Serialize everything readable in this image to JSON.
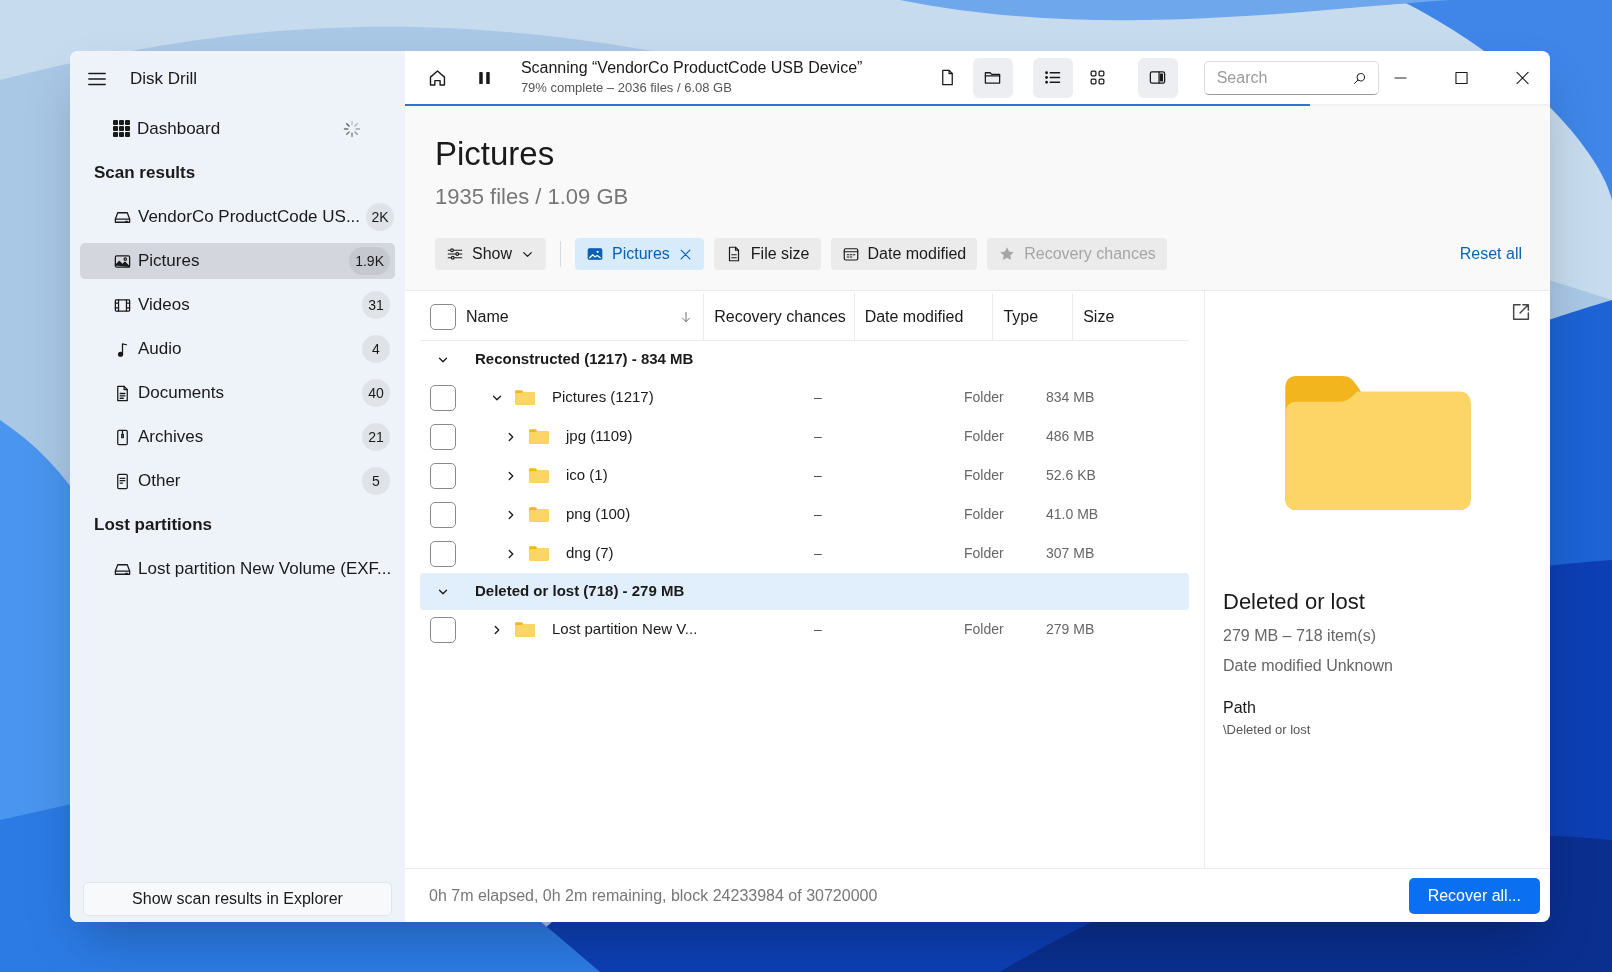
{
  "app": {
    "title": "Disk Drill"
  },
  "sidebar": {
    "dashboard": {
      "label": "Dashboard",
      "loading": true
    },
    "sections": [
      {
        "title": "Scan results",
        "items": [
          {
            "kind": "drive",
            "label": "VendorCo ProductCode US...",
            "count": "2K",
            "selected": false
          },
          {
            "kind": "picture",
            "label": "Pictures",
            "count": "1.9K",
            "selected": true
          },
          {
            "kind": "video",
            "label": "Videos",
            "count": "31",
            "selected": false
          },
          {
            "kind": "audio",
            "label": "Audio",
            "count": "4",
            "selected": false
          },
          {
            "kind": "document",
            "label": "Documents",
            "count": "40",
            "selected": false
          },
          {
            "kind": "archive",
            "label": "Archives",
            "count": "21",
            "selected": false
          },
          {
            "kind": "other",
            "label": "Other",
            "count": "5",
            "selected": false
          }
        ]
      },
      {
        "title": "Lost partitions",
        "items": [
          {
            "kind": "drive",
            "label": "Lost partition New Volume (EXF...",
            "selected": false
          }
        ]
      }
    ],
    "footer_button": "Show scan results in Explorer"
  },
  "toolbar": {
    "scan_title": "Scanning “VendorCo ProductCode USB Device”",
    "scan_status": "79% complete – 2036 files / 6.08 GB",
    "progress": {
      "level": 0.79
    },
    "view_buttons": [
      {
        "kind": "file",
        "selected": false
      },
      {
        "kind": "folder",
        "selected": true
      },
      {
        "kind": "list",
        "selected": true
      },
      {
        "kind": "grid",
        "selected": false
      },
      {
        "kind": "panel",
        "selected": true
      }
    ],
    "search": {
      "placeholder": "Search"
    }
  },
  "header": {
    "title": "Pictures",
    "subtitle": "1935 files / 1.09 GB"
  },
  "filters": [
    {
      "kind": "show",
      "label": "Show",
      "active": false,
      "disabled": false
    },
    {
      "kind": "picture",
      "label": "Pictures",
      "active": true,
      "disabled": false
    },
    {
      "kind": "file",
      "label": "File size",
      "active": false,
      "disabled": false
    },
    {
      "kind": "calendar",
      "label": "Date modified",
      "active": false,
      "disabled": false
    },
    {
      "kind": "star",
      "label": "Recovery chances",
      "active": false,
      "disabled": true
    }
  ],
  "reset_link": "Reset all",
  "table": {
    "select_all": {
      "checked": false
    },
    "columns": [
      "Name",
      "Recovery chances",
      "Date modified",
      "Type",
      "Size"
    ],
    "groups": [
      {
        "label": "Reconstructed (1217) - 834 MB",
        "expanded": true,
        "selected": false,
        "children": [
          {
            "name": "Pictures (1217)",
            "expanded": true,
            "checked": false,
            "recovery": "–",
            "type": "Folder",
            "size": "834 MB",
            "children": [
              {
                "name": "jpg (1109)",
                "expanded": false,
                "checked": false,
                "recovery": "–",
                "type": "Folder",
                "size": "486 MB"
              },
              {
                "name": "ico (1)",
                "expanded": false,
                "checked": false,
                "recovery": "–",
                "type": "Folder",
                "size": "52.6 KB"
              },
              {
                "name": "png (100)",
                "expanded": false,
                "checked": false,
                "recovery": "–",
                "type": "Folder",
                "size": "41.0 MB"
              },
              {
                "name": "dng (7)",
                "expanded": false,
                "checked": false,
                "recovery": "–",
                "type": "Folder",
                "size": "307 MB"
              }
            ]
          }
        ]
      },
      {
        "label": "Deleted or lost (718) - 279 MB",
        "expanded": true,
        "selected": true,
        "children": [
          {
            "name": "Lost partition New V...",
            "expanded": false,
            "checked": false,
            "recovery": "–",
            "type": "Folder",
            "size": "279 MB"
          }
        ]
      }
    ]
  },
  "preview": {
    "title": "Deleted or lost",
    "lines": [
      "279 MB – 718 item(s)",
      "Date modified Unknown"
    ],
    "path_label": "Path",
    "path": "\\Deleted or lost"
  },
  "status_bar": {
    "text": "0h 7m elapsed, 0h 2m remaining, block 24233984 of 30720000",
    "recover_button": "Recover all..."
  }
}
